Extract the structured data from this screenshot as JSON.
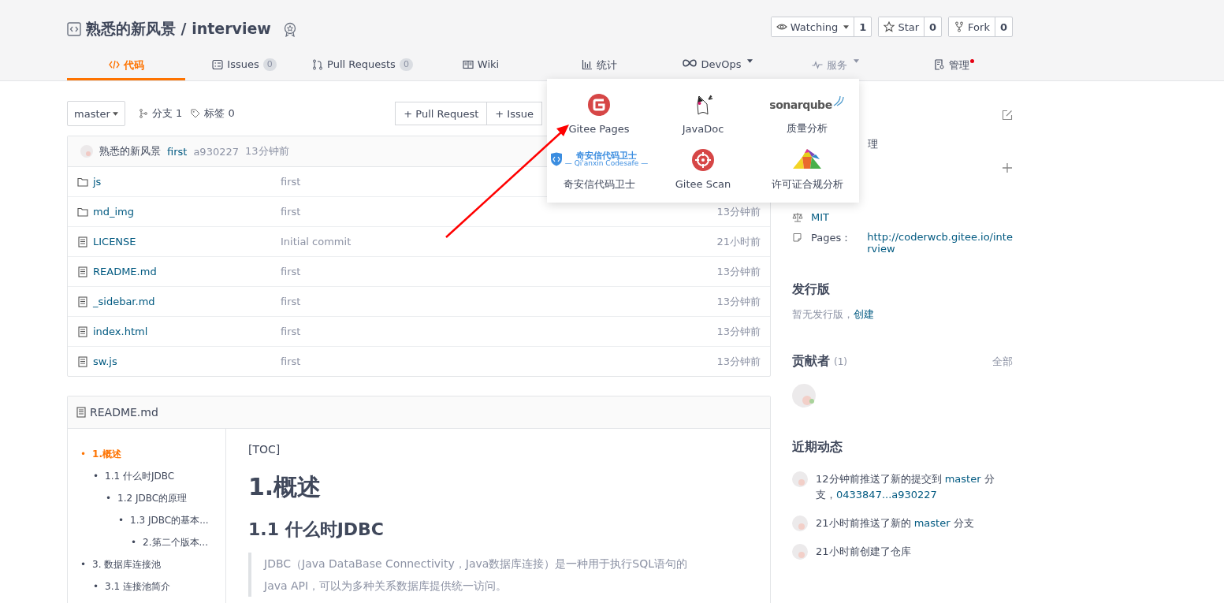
{
  "repo": {
    "title": "熟悉的新风景 / interview"
  },
  "actions": [
    {
      "kind": "watch",
      "label": "Watching",
      "count": "1"
    },
    {
      "kind": "star",
      "label": "Star",
      "count": "0"
    },
    {
      "kind": "fork",
      "label": "Fork",
      "count": "0"
    }
  ],
  "tabs": [
    {
      "kind": "code",
      "label": "代码",
      "selected": true,
      "open": false
    },
    {
      "kind": "issues",
      "label": "Issues",
      "count": "0",
      "selected": false,
      "open": false
    },
    {
      "kind": "pulls",
      "label": "Pull Requests",
      "count": "0",
      "selected": false,
      "open": false
    },
    {
      "kind": "wiki",
      "label": "Wiki",
      "selected": false,
      "open": false
    },
    {
      "kind": "stats",
      "label": "统计",
      "selected": false,
      "open": false
    },
    {
      "kind": "devops",
      "label": "DevOps",
      "menu": true,
      "selected": false,
      "open": false
    },
    {
      "kind": "services",
      "label": "服务",
      "menu": true,
      "selected": false,
      "open": true
    },
    {
      "kind": "manage",
      "label": "管理",
      "dot": true,
      "selected": false,
      "open": false
    }
  ],
  "toolbar": {
    "branch": "master",
    "branches": "分支 1",
    "tags": "标签 0",
    "buttons": [
      "+ Pull Request",
      "+ Issue"
    ]
  },
  "commit": {
    "author": "熟悉的新风景",
    "message": "first",
    "hash": "a930227",
    "time": "13分钟前"
  },
  "files": [
    {
      "kind": "folder",
      "name": "js",
      "message": "first"
    },
    {
      "kind": "folder",
      "name": "md_img",
      "message": "first",
      "time": "13分钟前"
    },
    {
      "kind": "file",
      "name": "LICENSE",
      "message": "Initial commit",
      "time": "21小时前"
    },
    {
      "kind": "file",
      "name": "README.md",
      "message": "first",
      "time": "13分钟前"
    },
    {
      "kind": "file",
      "name": "_sidebar.md",
      "message": "first",
      "time": "13分钟前"
    },
    {
      "kind": "file",
      "name": "index.html",
      "message": "first",
      "time": "13分钟前"
    },
    {
      "kind": "file",
      "name": "sw.js",
      "message": "first",
      "time": "13分钟前"
    }
  ],
  "services_menu": [
    {
      "kind": "gitee-pages",
      "label": "Gitee Pages"
    },
    {
      "kind": "javadoc",
      "label": "JavaDoc"
    },
    {
      "kind": "sonarqube",
      "label": "质量分析",
      "logo_text": "sonarqube"
    },
    {
      "kind": "qianxin",
      "label": "奇安信代码卫士",
      "logo_text": "奇安信代码卫士",
      "logo_subtext": "— Qi'anxin Codesafe —"
    },
    {
      "kind": "gitee-scan",
      "label": "Gitee Scan"
    },
    {
      "kind": "license",
      "label": "许可证合规分析"
    }
  ],
  "sidebar": {
    "partial_text": "理",
    "license": "MIT",
    "pages_label": "Pages：",
    "pages_url": "http://coderwcb.gitee.io/interview",
    "releases": {
      "title": "发行版",
      "text": "暂无发行版，",
      "link": "创建"
    },
    "contributors": {
      "title": "贡献者",
      "count": "(1)",
      "all": "全部"
    },
    "activity": {
      "title": "近期动态",
      "items": [
        [
          {
            "text": "12分钟前推送了新的提交到 "
          },
          {
            "text": "master",
            "link": true
          },
          {
            "text": " 分支，"
          },
          {
            "text": "0433847...a930227",
            "link": true
          }
        ],
        [
          {
            "text": "21小时前推送了新的 "
          },
          {
            "text": "master",
            "link": true
          },
          {
            "text": " 分支"
          }
        ],
        [
          {
            "text": "21小时前创建了仓库"
          }
        ]
      ]
    }
  },
  "readme": {
    "filename": "README.md",
    "toc": [
      {
        "bullet": "•",
        "label": "1.概述",
        "selected": true,
        "children": [
          {
            "bullet": "•",
            "label": "1.1 什么时JDBC",
            "selected": false,
            "children": [
              {
                "bullet": "•",
                "label": "1.2 JDBC的原理",
                "selected": false,
                "children": [
                  {
                    "bullet": "•",
                    "label": "1.3 JDBC的基本...",
                    "selected": false,
                    "children": [
                      {
                        "bullet": "•",
                        "label": "2.第二个版本...",
                        "selected": false
                      }
                    ]
                  }
                ]
              }
            ]
          }
        ]
      },
      {
        "bullet": "•",
        "label": "3. 数据库连接池",
        "selected": false,
        "children": [
          {
            "bullet": "•",
            "label": "3.1 连接池简介",
            "selected": false
          }
        ]
      }
    ],
    "toc_marker": "[TOC]",
    "h1": "1.概述",
    "h2": "1.1 什么时JDBC",
    "quote": "JDBC（Java DataBase Connectivity，Java数据库连接）是一种用于执行SQL语句的Java API，可以为多种关系数据库提供统一访问。"
  }
}
